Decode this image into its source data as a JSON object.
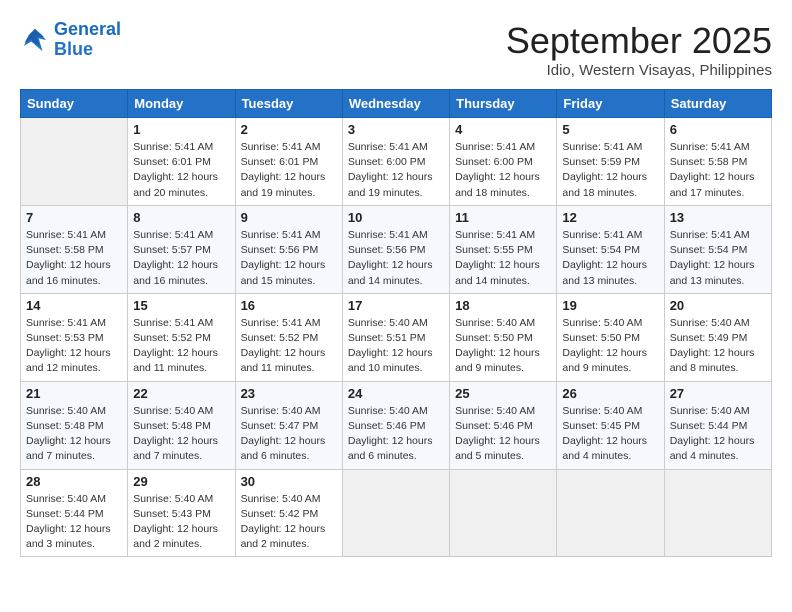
{
  "header": {
    "logo_line1": "General",
    "logo_line2": "Blue",
    "month": "September 2025",
    "location": "Idio, Western Visayas, Philippines"
  },
  "weekdays": [
    "Sunday",
    "Monday",
    "Tuesday",
    "Wednesday",
    "Thursday",
    "Friday",
    "Saturday"
  ],
  "weeks": [
    [
      {
        "day": null
      },
      {
        "day": 1,
        "sunrise": "5:41 AM",
        "sunset": "6:01 PM",
        "daylight": "12 hours and 20 minutes."
      },
      {
        "day": 2,
        "sunrise": "5:41 AM",
        "sunset": "6:01 PM",
        "daylight": "12 hours and 19 minutes."
      },
      {
        "day": 3,
        "sunrise": "5:41 AM",
        "sunset": "6:00 PM",
        "daylight": "12 hours and 19 minutes."
      },
      {
        "day": 4,
        "sunrise": "5:41 AM",
        "sunset": "6:00 PM",
        "daylight": "12 hours and 18 minutes."
      },
      {
        "day": 5,
        "sunrise": "5:41 AM",
        "sunset": "5:59 PM",
        "daylight": "12 hours and 18 minutes."
      },
      {
        "day": 6,
        "sunrise": "5:41 AM",
        "sunset": "5:58 PM",
        "daylight": "12 hours and 17 minutes."
      }
    ],
    [
      {
        "day": 7,
        "sunrise": "5:41 AM",
        "sunset": "5:58 PM",
        "daylight": "12 hours and 16 minutes."
      },
      {
        "day": 8,
        "sunrise": "5:41 AM",
        "sunset": "5:57 PM",
        "daylight": "12 hours and 16 minutes."
      },
      {
        "day": 9,
        "sunrise": "5:41 AM",
        "sunset": "5:56 PM",
        "daylight": "12 hours and 15 minutes."
      },
      {
        "day": 10,
        "sunrise": "5:41 AM",
        "sunset": "5:56 PM",
        "daylight": "12 hours and 14 minutes."
      },
      {
        "day": 11,
        "sunrise": "5:41 AM",
        "sunset": "5:55 PM",
        "daylight": "12 hours and 14 minutes."
      },
      {
        "day": 12,
        "sunrise": "5:41 AM",
        "sunset": "5:54 PM",
        "daylight": "12 hours and 13 minutes."
      },
      {
        "day": 13,
        "sunrise": "5:41 AM",
        "sunset": "5:54 PM",
        "daylight": "12 hours and 13 minutes."
      }
    ],
    [
      {
        "day": 14,
        "sunrise": "5:41 AM",
        "sunset": "5:53 PM",
        "daylight": "12 hours and 12 minutes."
      },
      {
        "day": 15,
        "sunrise": "5:41 AM",
        "sunset": "5:52 PM",
        "daylight": "12 hours and 11 minutes."
      },
      {
        "day": 16,
        "sunrise": "5:41 AM",
        "sunset": "5:52 PM",
        "daylight": "12 hours and 11 minutes."
      },
      {
        "day": 17,
        "sunrise": "5:40 AM",
        "sunset": "5:51 PM",
        "daylight": "12 hours and 10 minutes."
      },
      {
        "day": 18,
        "sunrise": "5:40 AM",
        "sunset": "5:50 PM",
        "daylight": "12 hours and 9 minutes."
      },
      {
        "day": 19,
        "sunrise": "5:40 AM",
        "sunset": "5:50 PM",
        "daylight": "12 hours and 9 minutes."
      },
      {
        "day": 20,
        "sunrise": "5:40 AM",
        "sunset": "5:49 PM",
        "daylight": "12 hours and 8 minutes."
      }
    ],
    [
      {
        "day": 21,
        "sunrise": "5:40 AM",
        "sunset": "5:48 PM",
        "daylight": "12 hours and 7 minutes."
      },
      {
        "day": 22,
        "sunrise": "5:40 AM",
        "sunset": "5:48 PM",
        "daylight": "12 hours and 7 minutes."
      },
      {
        "day": 23,
        "sunrise": "5:40 AM",
        "sunset": "5:47 PM",
        "daylight": "12 hours and 6 minutes."
      },
      {
        "day": 24,
        "sunrise": "5:40 AM",
        "sunset": "5:46 PM",
        "daylight": "12 hours and 6 minutes."
      },
      {
        "day": 25,
        "sunrise": "5:40 AM",
        "sunset": "5:46 PM",
        "daylight": "12 hours and 5 minutes."
      },
      {
        "day": 26,
        "sunrise": "5:40 AM",
        "sunset": "5:45 PM",
        "daylight": "12 hours and 4 minutes."
      },
      {
        "day": 27,
        "sunrise": "5:40 AM",
        "sunset": "5:44 PM",
        "daylight": "12 hours and 4 minutes."
      }
    ],
    [
      {
        "day": 28,
        "sunrise": "5:40 AM",
        "sunset": "5:44 PM",
        "daylight": "12 hours and 3 minutes."
      },
      {
        "day": 29,
        "sunrise": "5:40 AM",
        "sunset": "5:43 PM",
        "daylight": "12 hours and 2 minutes."
      },
      {
        "day": 30,
        "sunrise": "5:40 AM",
        "sunset": "5:42 PM",
        "daylight": "12 hours and 2 minutes."
      },
      {
        "day": null
      },
      {
        "day": null
      },
      {
        "day": null
      },
      {
        "day": null
      }
    ]
  ]
}
